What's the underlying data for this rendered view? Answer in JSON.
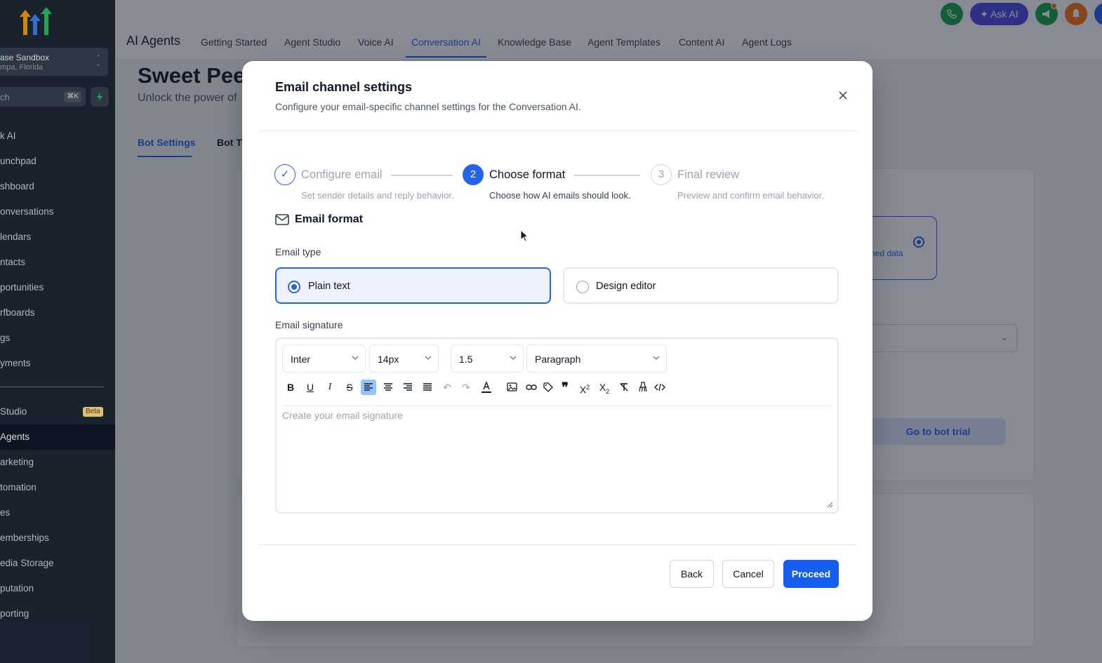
{
  "sidebar": {
    "location_name": "ase Sandbox",
    "location_sub": "mpa, Florida",
    "search_placeholder": "ch",
    "search_shortcut": "⌘K",
    "items": [
      {
        "label": "k AI",
        "active": false
      },
      {
        "label": "unchpad",
        "active": false
      },
      {
        "label": "shboard",
        "active": false
      },
      {
        "label": "onversations",
        "active": false
      },
      {
        "label": "lendars",
        "active": false
      },
      {
        "label": "ntacts",
        "active": false
      },
      {
        "label": "portunities",
        "active": false
      },
      {
        "label": "rfboards",
        "active": false
      },
      {
        "label": "gs",
        "active": false
      },
      {
        "label": "yments",
        "active": false
      },
      {
        "label": "Studio",
        "active": false,
        "badge": "Beta"
      },
      {
        "label": "Agents",
        "active": true
      },
      {
        "label": "arketing",
        "active": false
      },
      {
        "label": "tomation",
        "active": false
      },
      {
        "label": "es",
        "active": false
      },
      {
        "label": "emberships",
        "active": false
      },
      {
        "label": "edia Storage",
        "active": false
      },
      {
        "label": "putation",
        "active": false
      },
      {
        "label": "porting",
        "active": false
      }
    ]
  },
  "topbar": {
    "title": "AI Agents",
    "tabs": [
      {
        "label": "Getting Started"
      },
      {
        "label": "Agent Studio"
      },
      {
        "label": "Voice AI"
      },
      {
        "label": "Conversation AI",
        "active": true
      },
      {
        "label": "Knowledge Base"
      },
      {
        "label": "Agent Templates"
      },
      {
        "label": "Content AI"
      },
      {
        "label": "Agent Logs"
      }
    ],
    "ask_ai_label": "Ask AI",
    "icons": [
      "phone-icon",
      "sparkle-icon",
      "megaphone-icon",
      "bell-icon"
    ]
  },
  "page": {
    "heading": "Sweet Peel",
    "subheading": "Unlock the power of",
    "tabs": [
      {
        "label": "Bot Settings",
        "active": true
      },
      {
        "label": "Bot Tr"
      }
    ],
    "option_text": "ned data",
    "trial_button": "Go to bot trial"
  },
  "modal": {
    "title": "Email channel settings",
    "description": "Configure your email-specific channel settings for the Conversation AI.",
    "steps": [
      {
        "number": "✓",
        "title": "Configure email",
        "description": "Set sender details and reply behavior.",
        "state": "done"
      },
      {
        "number": "2",
        "title": "Choose format",
        "description": "Choose how AI emails should look.",
        "state": "active"
      },
      {
        "number": "3",
        "title": "Final review",
        "description": "Preview and confirm email behavior.",
        "state": "todo"
      }
    ],
    "section_title": "Email format",
    "email_type_label": "Email type",
    "email_type_options": [
      {
        "label": "Plain text",
        "selected": true
      },
      {
        "label": "Design editor",
        "selected": false
      }
    ],
    "signature_label": "Email signature",
    "editor": {
      "font": "Inter",
      "size": "14px",
      "line_height": "1.5",
      "block": "Paragraph",
      "placeholder": "Create your email signature",
      "tools": [
        "bold-icon",
        "underline-icon",
        "italic-icon",
        "strikethrough-icon",
        "align-left-icon",
        "align-center-icon",
        "align-right-icon",
        "align-justify-icon",
        "undo-icon",
        "redo-icon",
        "text-color-icon",
        "image-icon",
        "link-icon",
        "tag-icon",
        "quote-icon",
        "superscript-icon",
        "subscript-icon",
        "clear-format-icon",
        "clear-all-icon",
        "code-icon"
      ]
    },
    "buttons": {
      "back": "Back",
      "cancel": "Cancel",
      "proceed": "Proceed"
    }
  },
  "colors": {
    "accent": "#2563eb",
    "primary_button": "#155eef",
    "sidebar_bg": "#1f2937"
  }
}
